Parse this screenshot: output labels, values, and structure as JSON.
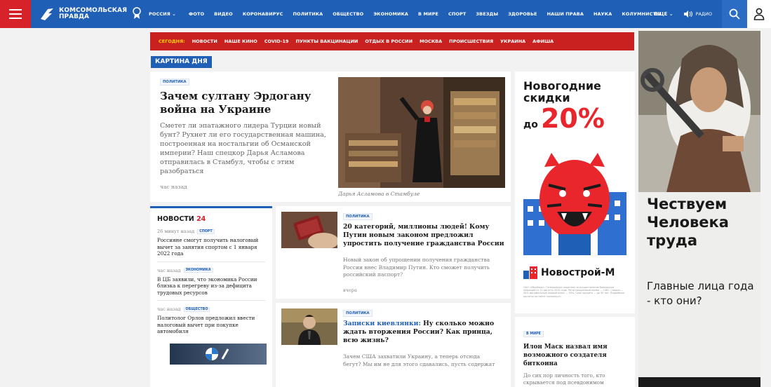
{
  "header": {
    "logo_text_line1": "комсомольская",
    "logo_text_line2": "правда",
    "region": "РОССИЯ",
    "nav": [
      "ФОТО",
      "ВИДЕО",
      "КОРОНАВИРУС",
      "ПОЛИТИКА",
      "ОБЩЕСТВО",
      "ЭКОНОМИКА",
      "В МИРЕ",
      "СПОРТ",
      "ЗВЕЗДЫ",
      "ЗДОРОВЬЕ",
      "НАШИ ПРАВА",
      "НАУКА",
      "КОЛУМНИСТЫ"
    ],
    "more": "ЕЩЕ",
    "radio": "РАДИО",
    "accent": "#1f5fb5",
    "burger_color": "#d8222a"
  },
  "today_strip": {
    "label": "СЕГОДНЯ:",
    "items": [
      "НОВОСТИ",
      "НАШЕ КИНО",
      "COVID-19",
      "ПУНКТЫ ВАКЦИНАЦИИ",
      "ОТДЫХ В РОССИИ",
      "МОСКВА",
      "ПРОИСШЕСТВИЯ",
      "УКРАИНА",
      "АФИША"
    ]
  },
  "picture_of_day": {
    "label": "КАРТИНА ДНЯ",
    "tag": "ПОЛИТИКА",
    "title": "Зачем султану Эрдогану война на Украине",
    "description": "Сметет ли эпатажного лидера Турции новый бунт? Рухнет ли его государственная машина, построенная на ностальгии об Османской империи? Наш спецкор Дарья Асламова отправилась в Стамбул, чтобы с этим разобраться",
    "time": "час назад",
    "caption": "Дарья Асламова в Стамбуле"
  },
  "news24": {
    "title": "НОВОСТИ",
    "number": "24",
    "items": [
      {
        "time": "26 минут назад",
        "tag": "СПОРТ",
        "text": "Россияне смогут получить налоговый вычет за занятия спортом с 1 января 2022 года"
      },
      {
        "time": "час назад",
        "tag": "ЭКОНОМИКА",
        "text": "В ЦБ заявили, что экономика России близка к перегреву из-за дефицита трудовых ресурсов"
      },
      {
        "time": "час назад",
        "tag": "ОБЩЕСТВО",
        "text": "Политолог Орлов предложил ввести налоговый вычет при покупке автомобиля"
      }
    ]
  },
  "cards": [
    {
      "tag": "ПОЛИТИКА",
      "title": "20 категорий, миллионы людей! Кому Путин новым законом предложил упростить получение гражданства России",
      "description": "Новый закон об упрощении получения гражданства России внес Владимир Путин. Кто сможет получить российский паспорт?",
      "time": "вчера"
    },
    {
      "tag": "ПОЛИТИКА",
      "title_highlight": "Записки киевлянки:",
      "title": "Ну сколько можно ждать вторжения России? Как принца, всю жизнь?",
      "description": "Зачем США захватили Украину, а теперь отсюда бегут? Мы им не для этого сдавались, пусть содержат",
      "time": "вчера"
    }
  ],
  "ad_small": {
    "title": "Новогодние скидки",
    "percent_pre": "до",
    "percent": "20%",
    "brand": "Новострой-М",
    "fine": "ОАО «Сбербанк». Генеральная лицензия на осуществление банковских операций от 11 августа 2015 года. Регистрационный номер — 1481. Скидка — 20% минимальный первый взнос — 50%. Срок кредита — до 30 лет. Подробные расчеты на сайте novostroy.ru"
  },
  "right_news": {
    "tag": "В МИРЕ",
    "title": "Илон Маск назвал имя возможного создателя биткоина",
    "description": "До сих пор личность того, кто скрывается под псевдонимом"
  },
  "banner": {
    "heading": "Чествуем Человека труда",
    "sub": "Главные лица года - кто они?"
  }
}
